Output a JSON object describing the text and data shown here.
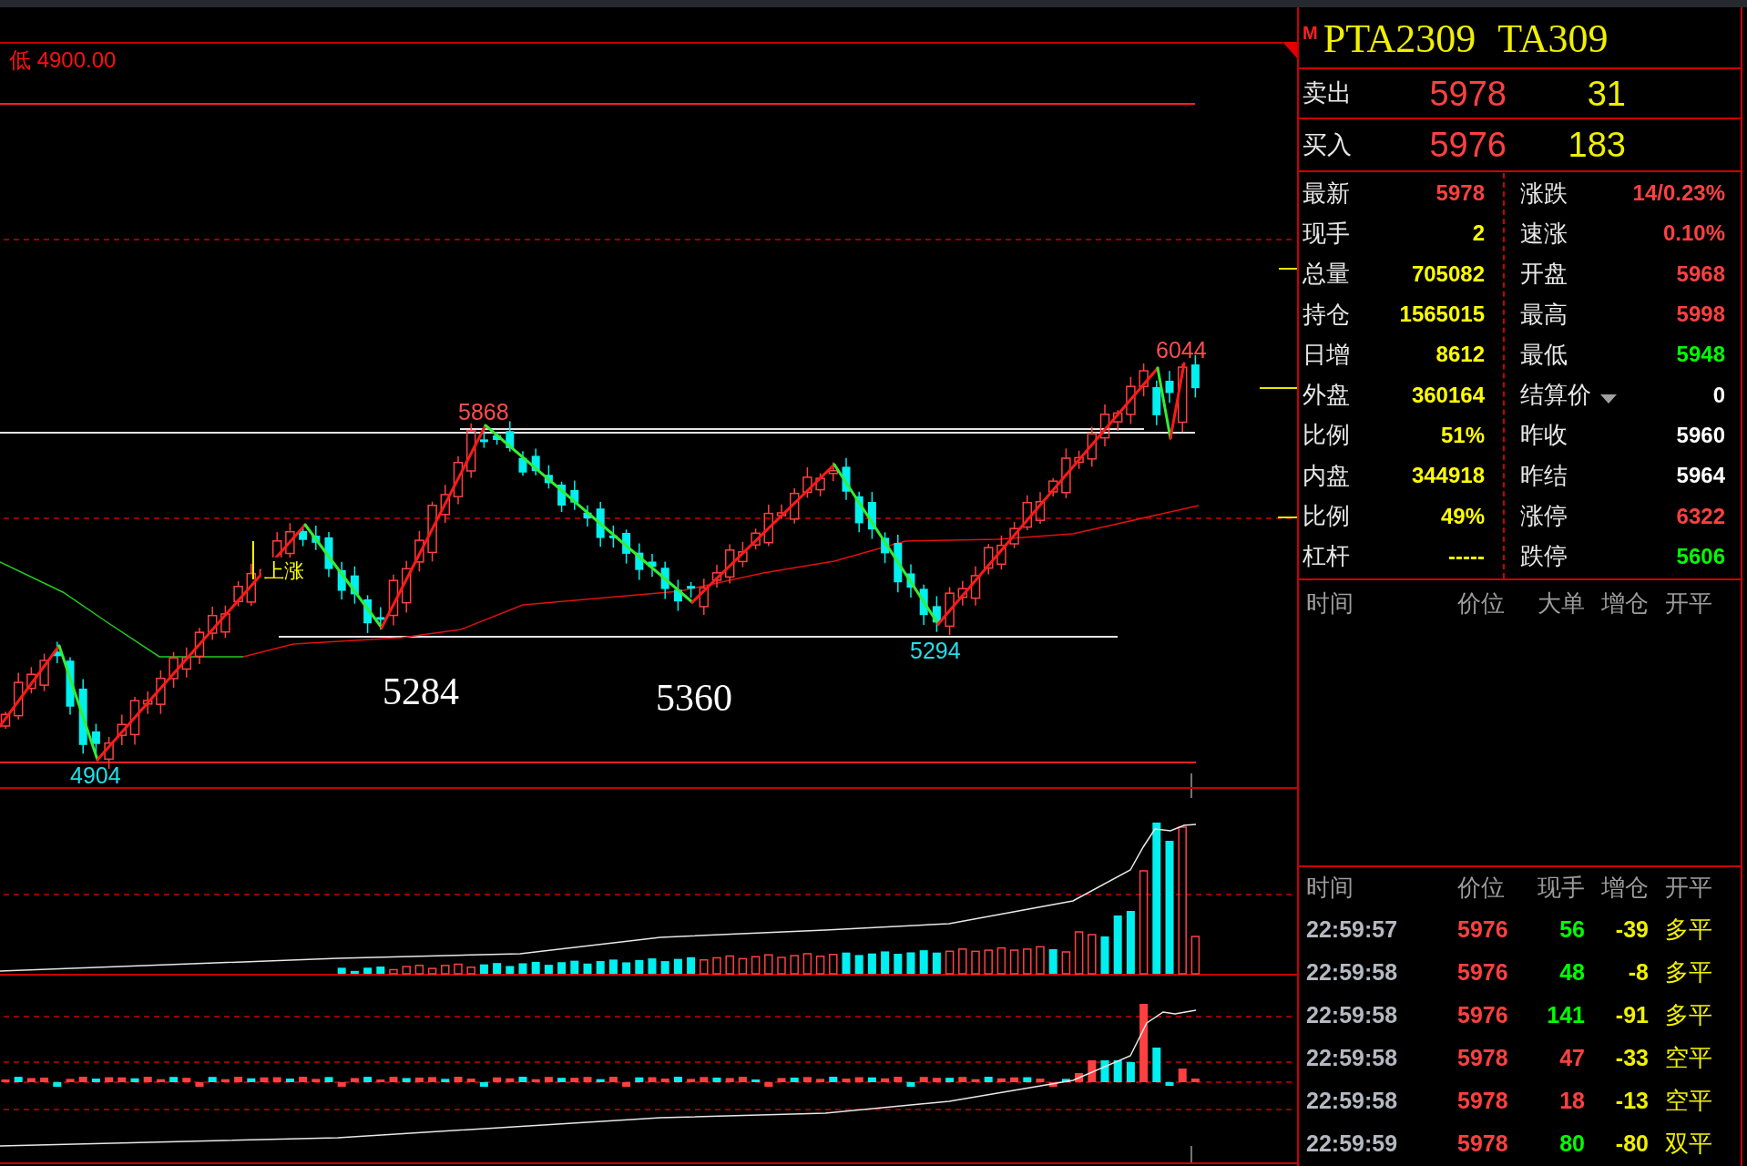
{
  "price_chart": {
    "range_label": "低 4900.00",
    "labels": [
      {
        "kind": "high",
        "text": "5868"
      },
      {
        "kind": "high",
        "text": "6044"
      },
      {
        "kind": "low",
        "text": "4904"
      },
      {
        "kind": "low",
        "text": "5294"
      },
      {
        "kind": "level",
        "text": "5284"
      },
      {
        "kind": "level",
        "text": "5360"
      },
      {
        "kind": "signal",
        "text": "上涨"
      }
    ]
  },
  "quote": {
    "flag": "M",
    "symbol": "PTA2309",
    "code": "TA309",
    "ask": {
      "label": "卖出",
      "price": "5978",
      "volume": "31"
    },
    "bid": {
      "label": "买入",
      "price": "5976",
      "volume": "183"
    },
    "stats_left": [
      {
        "label": "最新",
        "value": "5978",
        "color": "#ff4040"
      },
      {
        "label": "现手",
        "value": "2",
        "color": "#ffff00"
      },
      {
        "label": "总量",
        "value": "705082",
        "color": "#ffff00"
      },
      {
        "label": "持仓",
        "value": "1565015",
        "color": "#ffff00"
      },
      {
        "label": "日增",
        "value": "8612",
        "color": "#ffff00"
      },
      {
        "label": "外盘",
        "value": "360164",
        "color": "#ffff00"
      },
      {
        "label": "比例",
        "value": "51%",
        "color": "#ffff00"
      },
      {
        "label": "内盘",
        "value": "344918",
        "color": "#ffff00"
      },
      {
        "label": "比例",
        "value": "49%",
        "color": "#ffff00"
      },
      {
        "label": "杠杆",
        "value": "-----",
        "color": "#ffff00"
      }
    ],
    "stats_right": [
      {
        "kind": "plain",
        "label": "涨跌",
        "value": "14/0.23%",
        "color": "#ff4040"
      },
      {
        "kind": "plain",
        "label": "速涨",
        "value": "0.10%",
        "color": "#ff4040"
      },
      {
        "kind": "plain",
        "label": "开盘",
        "value": "5968",
        "color": "#ff4040"
      },
      {
        "kind": "plain",
        "label": "最高",
        "value": "5998",
        "color": "#ff4040"
      },
      {
        "kind": "plain",
        "label": "最低",
        "value": "5948",
        "color": "#00ff00"
      },
      {
        "kind": "dropdown",
        "label": "结算价",
        "value": "0",
        "color": "#ffffff"
      },
      {
        "kind": "plain",
        "label": "昨收",
        "value": "5960",
        "color": "#ffffff"
      },
      {
        "kind": "plain",
        "label": "昨结",
        "value": "5964",
        "color": "#ffffff"
      },
      {
        "kind": "plain",
        "label": "涨停",
        "value": "6322",
        "color": "#ff4040"
      },
      {
        "kind": "plain",
        "label": "跌停",
        "value": "5606",
        "color": "#00ff00"
      }
    ]
  },
  "big_orders": {
    "columns": [
      "时间",
      "价位",
      "大单",
      "增仓",
      "开平"
    ]
  },
  "ticks": {
    "columns": [
      "时间",
      "价位",
      "现手",
      "增仓",
      "开平"
    ],
    "rows": [
      {
        "time": "22:59:57",
        "price": "5976",
        "volume": "56",
        "color": "#00ff00",
        "oi_change": "-39",
        "type": "多平"
      },
      {
        "time": "22:59:58",
        "price": "5976",
        "volume": "48",
        "color": "#00ff00",
        "oi_change": "-8",
        "type": "多平"
      },
      {
        "time": "22:59:58",
        "price": "5976",
        "volume": "141",
        "color": "#00ff00",
        "oi_change": "-91",
        "type": "多平"
      },
      {
        "time": "22:59:58",
        "price": "5978",
        "volume": "47",
        "color": "#ff4040",
        "oi_change": "-33",
        "type": "空平"
      },
      {
        "time": "22:59:58",
        "price": "5978",
        "volume": "18",
        "color": "#ff4040",
        "oi_change": "-13",
        "type": "空平"
      },
      {
        "time": "22:59:59",
        "price": "5978",
        "volume": "80",
        "color": "#00ff00",
        "oi_change": "-80",
        "type": "双平"
      }
    ]
  }
}
